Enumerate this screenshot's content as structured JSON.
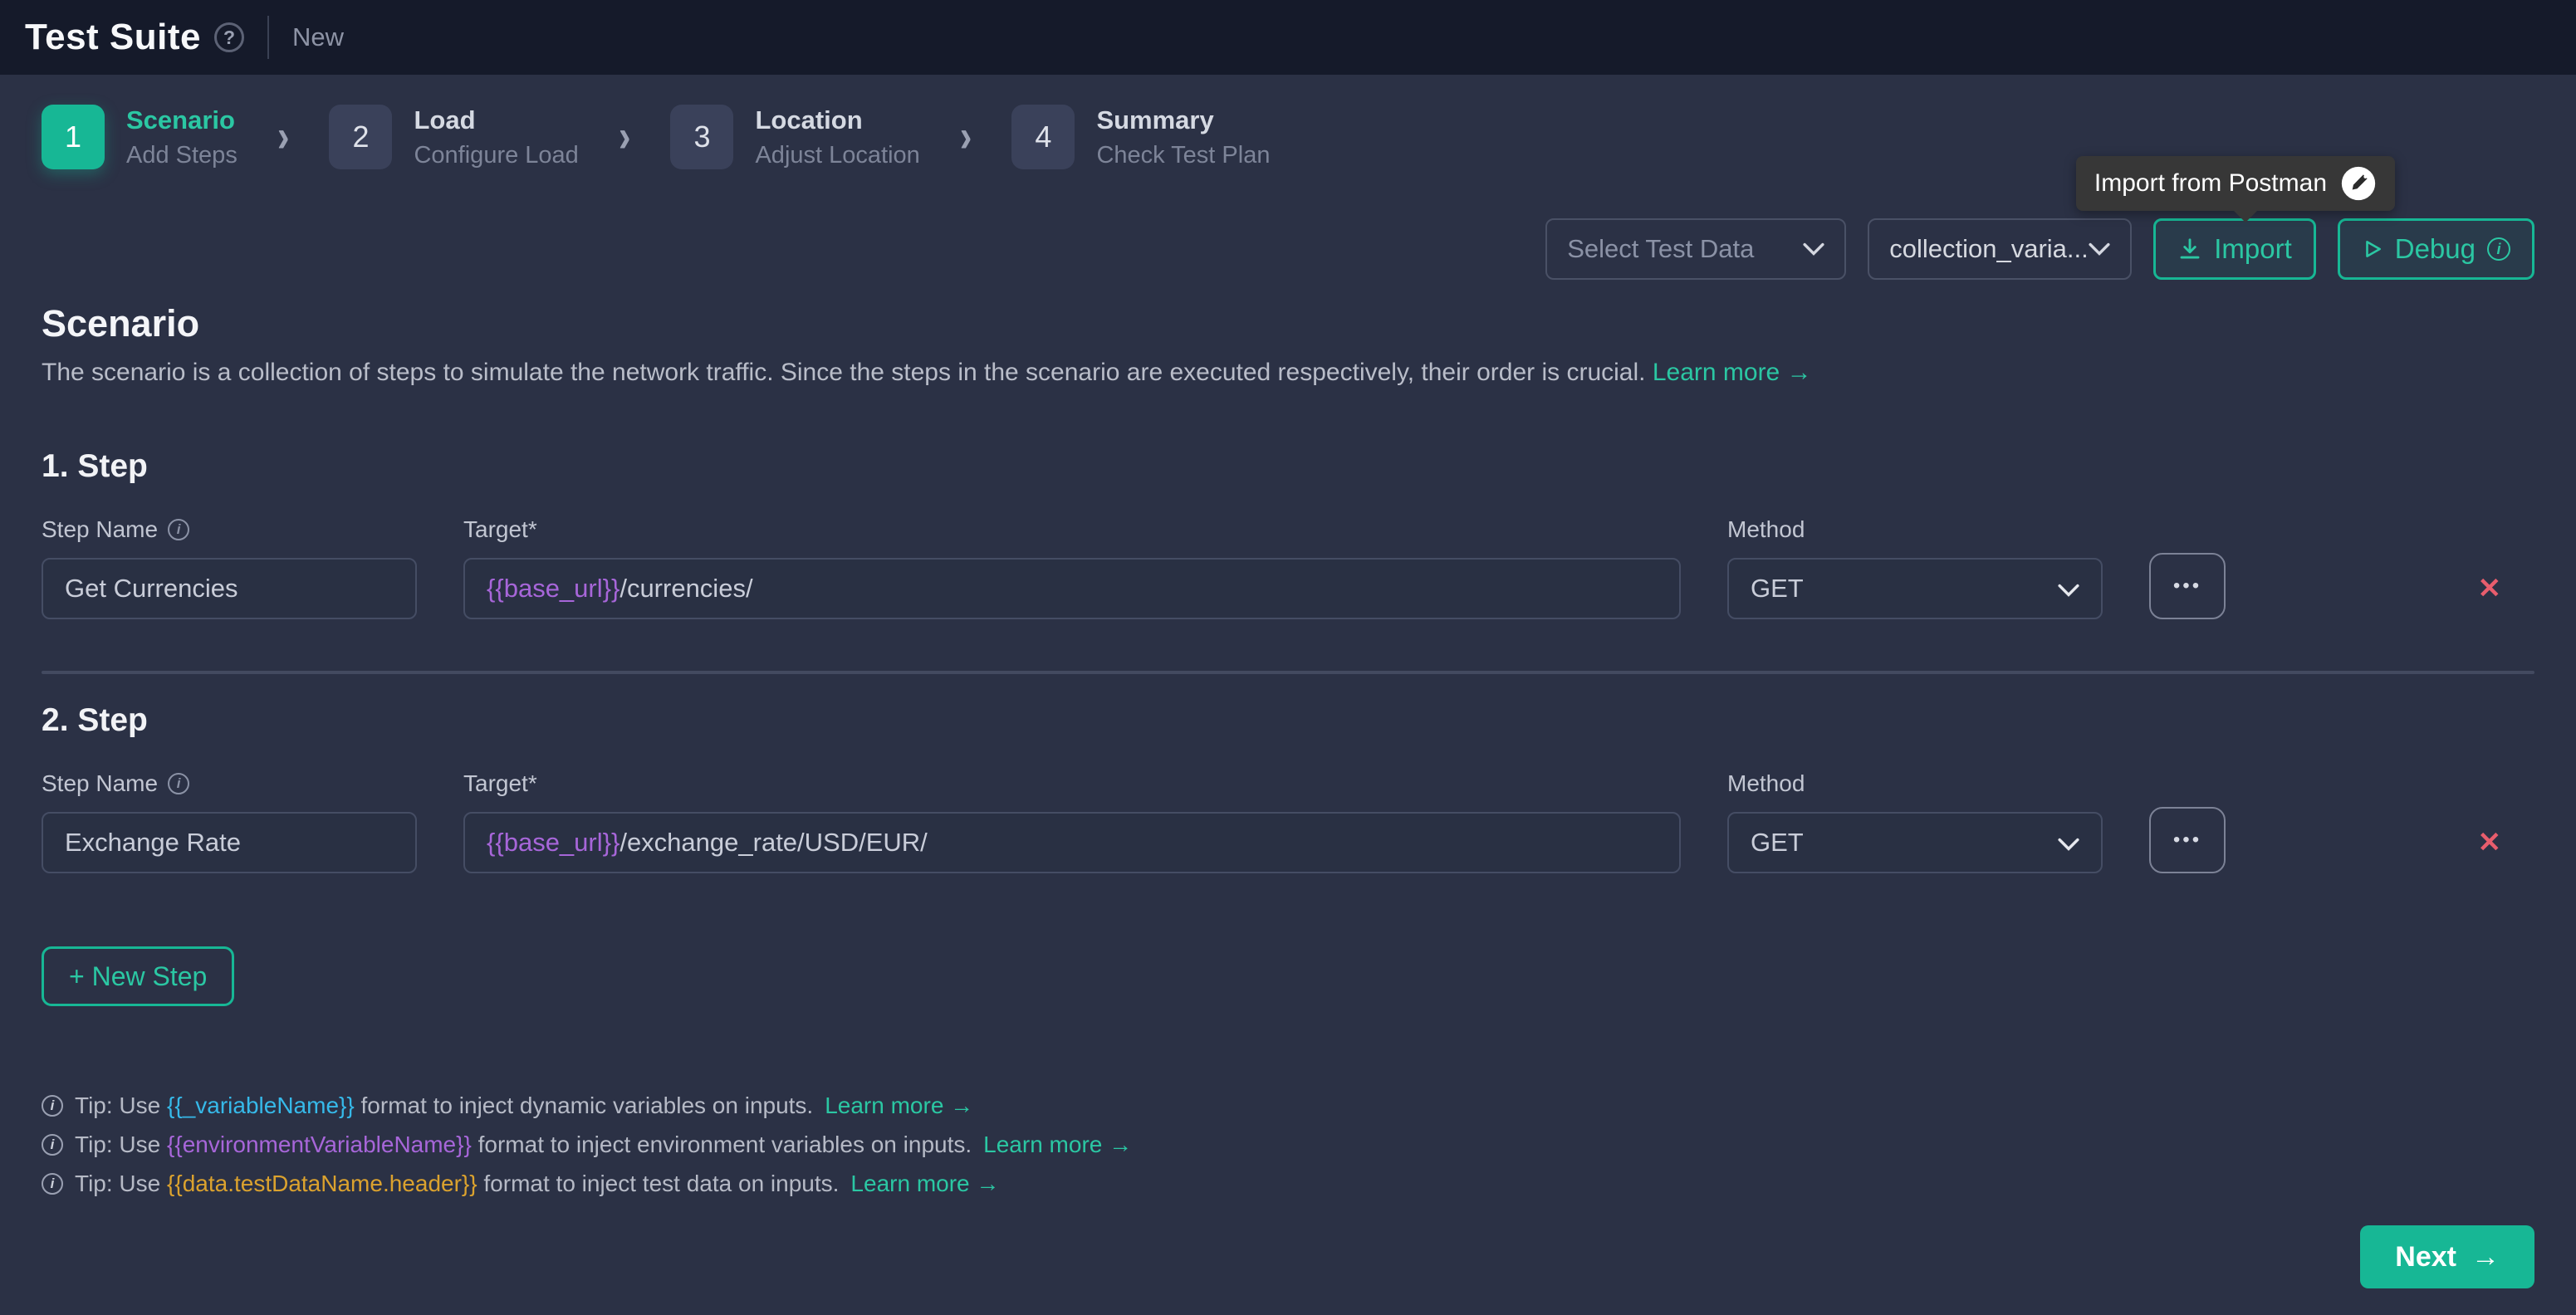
{
  "colors": {
    "page-bg": "#2b3145",
    "header-bg": "#151a2a",
    "accent": "#17b795",
    "accent-text": "#2bc7a3",
    "red": "#e85d6d",
    "purple": "#a766d9",
    "tip-cyan": "#36b9e9",
    "tip-purple": "#a766d9",
    "tip-orange": "#dba22e"
  },
  "icons": {
    "help": "?",
    "chevron_right": "›",
    "info": "i",
    "dots": "•••",
    "close": "✕",
    "arrow_right": "→"
  },
  "header": {
    "title": "Test Suite",
    "subtitle": "New"
  },
  "stepper": [
    {
      "number": "1",
      "title": "Scenario",
      "subtitle": "Add Steps"
    },
    {
      "number": "2",
      "title": "Load",
      "subtitle": "Configure Load"
    },
    {
      "number": "3",
      "title": "Location",
      "subtitle": "Adjust Location"
    },
    {
      "number": "4",
      "title": "Summary",
      "subtitle": "Check Test Plan"
    }
  ],
  "tooltip": {
    "label": "Import from Postman"
  },
  "toolbar": {
    "test_data_placeholder": "Select Test Data",
    "environment_value": "collection_varia...",
    "import_label": "Import",
    "debug_label": "Debug"
  },
  "scenario": {
    "title": "Scenario",
    "description": "The scenario is a collection of steps to simulate the network traffic. Since the steps in the scenario are executed respectively, their order is crucial. ",
    "learn_more": "Learn more →"
  },
  "labels": {
    "step_name": "Step Name",
    "target": "Target*",
    "method": "Method"
  },
  "steps": [
    {
      "heading": "1. Step",
      "name": "Get Currencies",
      "target_variable": "{{base_url}}",
      "target_path": "/currencies/",
      "method": "GET"
    },
    {
      "heading": "2. Step",
      "name": "Exchange Rate",
      "target_variable": "{{base_url}}",
      "target_path": "/exchange_rate/USD/EUR/",
      "method": "GET"
    }
  ],
  "new_step_label": "+ New Step",
  "tips": [
    {
      "prefix": "Tip: Use ",
      "variable": "{{_variableName}}",
      "suffix": " format to inject dynamic variables on inputs. ",
      "link": "Learn more →"
    },
    {
      "prefix": "Tip: Use ",
      "variable": "{{environmentVariableName}}",
      "suffix": " format to inject environment variables on inputs. ",
      "link": "Learn more →"
    },
    {
      "prefix": "Tip: Use ",
      "variable": "{{data.testDataName.header}}",
      "suffix": " format to inject test data on inputs. ",
      "link": "Learn more →"
    }
  ],
  "next": {
    "label": "Next",
    "icon": "→"
  }
}
